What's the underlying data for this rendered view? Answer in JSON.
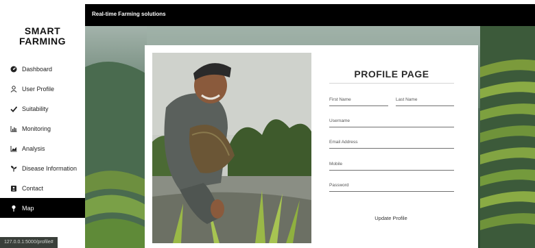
{
  "sidebar": {
    "brand_line1": "SMART",
    "brand_line2": "FARMING",
    "items": [
      {
        "label": "Dashboard",
        "icon": "dashboard-icon"
      },
      {
        "label": "User Profile",
        "icon": "user-icon"
      },
      {
        "label": "Suitability",
        "icon": "check-icon"
      },
      {
        "label": "Monitoring",
        "icon": "bar-chart-icon"
      },
      {
        "label": "Analysis",
        "icon": "area-chart-icon"
      },
      {
        "label": "Disease Information",
        "icon": "seedling-icon"
      },
      {
        "label": "Contact",
        "icon": "contact-card-icon"
      },
      {
        "label": "Map",
        "icon": "map-pin-icon",
        "active": true
      }
    ]
  },
  "topbar": {
    "title": "Real-time Farming solutions"
  },
  "status_url": "127.0.0.1:5000/profile#",
  "profile": {
    "title": "PROFILE PAGE",
    "fields": {
      "first_name": "First Name",
      "last_name": "Last Name",
      "username": "Username",
      "email": "Email Address",
      "mobile": "Mobile",
      "password": "Password"
    },
    "update_label": "Update Profile"
  },
  "colors": {
    "topbar": "#000000",
    "active_nav": "#000000",
    "card": "#ffffff"
  }
}
